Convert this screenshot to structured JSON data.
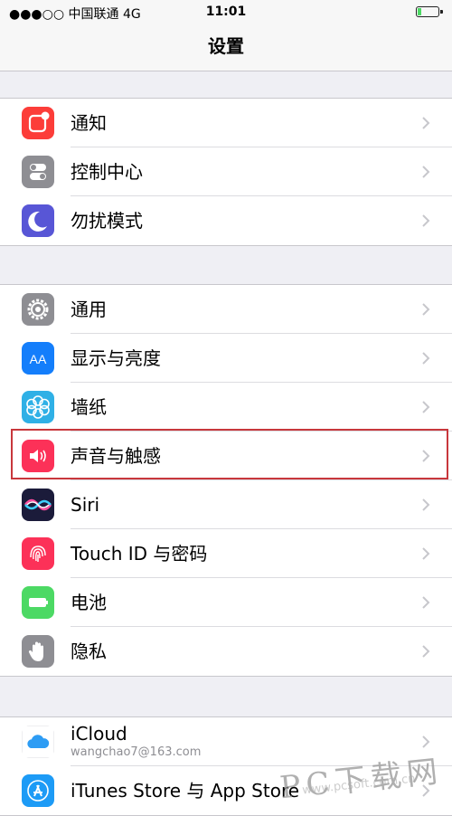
{
  "status_bar": {
    "signal": "●●●○○ 中国联通    4G",
    "time": "11:01",
    "battery_level": 0.2
  },
  "nav": {
    "title": "设置"
  },
  "groups": [
    {
      "items": [
        {
          "label": "通知",
          "icon": "notifications-icon",
          "color": "#fc3d39"
        },
        {
          "label": "控制中心",
          "icon": "control-center-icon",
          "color": "#8e8e93"
        },
        {
          "label": "勿扰模式",
          "icon": "moon-icon",
          "color": "#5856d6"
        }
      ]
    },
    {
      "items": [
        {
          "label": "通用",
          "icon": "gear-icon",
          "color": "#8e8e93"
        },
        {
          "label": "显示与亮度",
          "icon": "display-icon",
          "color": "#147efb"
        },
        {
          "label": "墙纸",
          "icon": "wallpaper-flower-icon",
          "color": "#2fb0e6"
        },
        {
          "label": "声音与触感",
          "icon": "speaker-icon",
          "color": "#fc3158"
        },
        {
          "label": "Siri",
          "icon": "siri-icon",
          "color": "#1b1b3a"
        },
        {
          "label": "Touch ID 与密码",
          "icon": "fingerprint-icon",
          "color": "#fc3158"
        },
        {
          "label": "电池",
          "icon": "battery-icon",
          "color": "#4cd964"
        },
        {
          "label": "隐私",
          "icon": "hand-icon",
          "color": "#8e8e93"
        }
      ]
    },
    {
      "items": [
        {
          "label": "iCloud",
          "sublabel": "wangchao7@163.com",
          "icon": "icloud-icon",
          "color": "#ffffff"
        },
        {
          "label": "iTunes Store 与 App Store",
          "icon": "app-store-icon",
          "color": "#1d9bf6"
        }
      ]
    }
  ],
  "watermark": {
    "brand": "PC下载网",
    "url": "www.pcsoft.com.cn"
  }
}
